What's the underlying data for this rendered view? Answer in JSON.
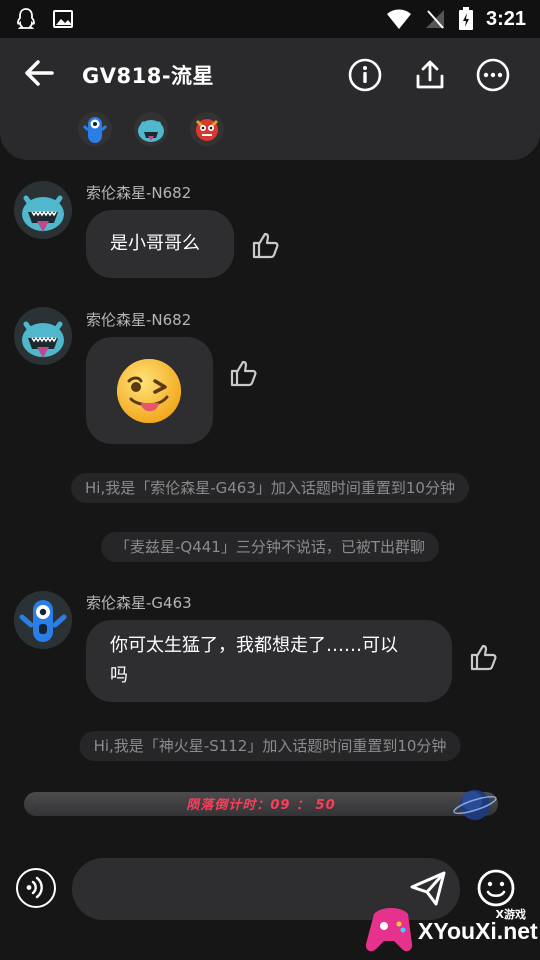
{
  "status_bar": {
    "time": "3:21"
  },
  "header": {
    "title": "GV818-流星",
    "icons": [
      "back-arrow-icon",
      "info-icon",
      "share-icon",
      "more-icon"
    ]
  },
  "messages": [
    {
      "sender": "索伦森星-N682",
      "text": "是小哥哥么"
    },
    {
      "sender": "索伦森星-N682",
      "text": "😜"
    },
    {
      "sender": "索伦森星-G463",
      "line1": "你可太生猛了，我都想走了……可以",
      "line2": "吗"
    }
  ],
  "system_messages": [
    "Hi,我是「索伦森星-G463」加入话题时间重置到10分钟",
    "「麦兹星-Q441」三分钟不说话，已被T出群聊",
    "Hi,我是「神火星-S112」加入话题时间重置到10分钟"
  ],
  "countdown": {
    "label": "陨落倒计时：",
    "minutes": "09",
    "separator": "：",
    "seconds": "50"
  },
  "input": {
    "value": "",
    "placeholder": ""
  },
  "colors": {
    "background": "#161616",
    "bubble": "#2e2e30",
    "countdown_text": "#ff3c5a"
  },
  "watermark": {
    "small": "X游戏",
    "big": "XYouXi.net"
  }
}
